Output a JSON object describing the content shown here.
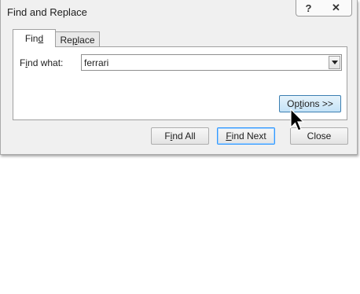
{
  "window": {
    "title": "Find and Replace",
    "help_glyph": "?",
    "close_glyph": "✕"
  },
  "tabs": [
    {
      "label_pre": "Fin",
      "label_key": "d",
      "label_post": "",
      "active": true
    },
    {
      "label_pre": "Re",
      "label_key": "p",
      "label_post": "lace",
      "active": false
    }
  ],
  "find": {
    "label_pre": "F",
    "label_key": "i",
    "label_post": "nd what:",
    "value": "ferrari"
  },
  "buttons": {
    "options": {
      "pre": "Op",
      "key": "t",
      "post": "ions >>"
    },
    "find_all": {
      "pre": "F",
      "key": "i",
      "post": "nd All",
      "underline_first": true
    },
    "find_next": {
      "pre": "",
      "key": "F",
      "post": "ind Next"
    },
    "close": {
      "pre": "Close",
      "key": "",
      "post": ""
    }
  }
}
